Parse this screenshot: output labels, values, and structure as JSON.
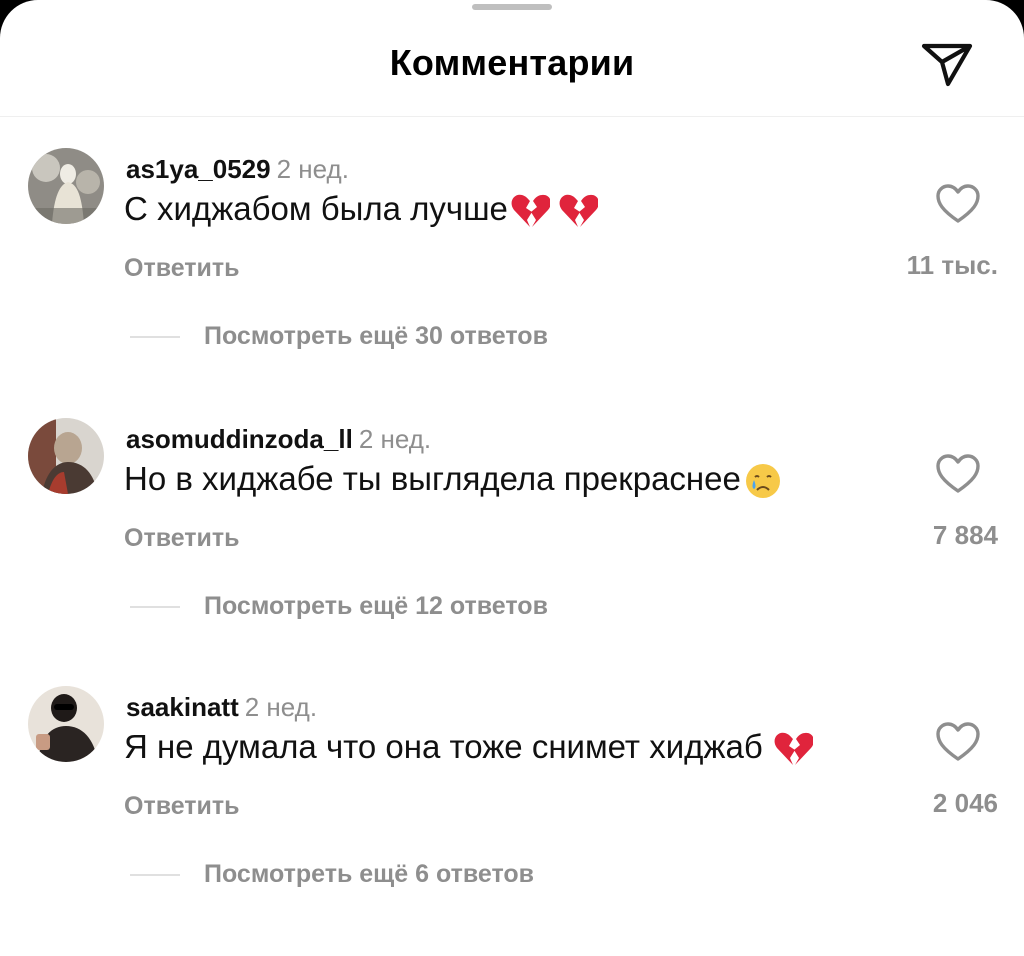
{
  "header": {
    "title": "Комментарии",
    "send_icon": "paper-plane-icon"
  },
  "comments": [
    {
      "username": "as1ya_0529",
      "time": "2 нед.",
      "text": "С хиджабом была лучше",
      "emojis": [
        "broken-heart",
        "broken-heart"
      ],
      "reply_label": "Ответить",
      "likes": "11 тыс.",
      "more_replies": "Посмотреть ещё 30 ответов"
    },
    {
      "username": "asomuddinzoda_ll",
      "time": "2 нед.",
      "text": "Но в хиджабе ты выглядела прекраснее",
      "emojis": [
        "crying-face"
      ],
      "reply_label": "Ответить",
      "likes": "7 884",
      "more_replies": "Посмотреть ещё 12 ответов"
    },
    {
      "username": "saakinatt",
      "time": "2 нед.",
      "text": "Я не думала что она тоже снимет хиджаб",
      "emojis": [
        "broken-heart"
      ],
      "reply_label": "Ответить",
      "likes": "2 046",
      "more_replies": "Посмотреть ещё 6 ответов"
    }
  ],
  "colors": {
    "secondary_text": "#8e8e8e",
    "broken_heart": "#e0243c"
  }
}
